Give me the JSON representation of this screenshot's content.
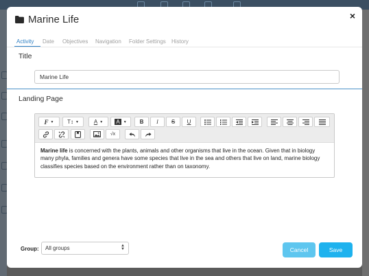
{
  "modal": {
    "title": "Marine Life",
    "close_label": "×"
  },
  "tabs": [
    {
      "label": "Activity",
      "active": true
    },
    {
      "label": "Date"
    },
    {
      "label": "Objectives"
    },
    {
      "label": "Navigation"
    },
    {
      "label": "Folder Settings"
    },
    {
      "label": "History"
    }
  ],
  "title_section": {
    "label": "Title",
    "value": "Marine Life"
  },
  "landing_section": {
    "label": "Landing Page"
  },
  "toolbar": {
    "font_label": "F",
    "size_label": "T↕",
    "color_label": "A",
    "bg_label": "A",
    "bold_label": "B",
    "italic_label": "I",
    "strike_label": "S",
    "underline_label": "U",
    "formula_label": "√x"
  },
  "editor": {
    "bold_lead": "Marine life",
    "body": " is concerned with the plants, animals and other organisms that live in the ocean. Given that in biology many phyla, families and genera have some species that live in the sea and others that live on land, marine biology classifies species based on the environment rather than on taxonomy."
  },
  "footer": {
    "group_label": "Group:",
    "group_value": "All groups",
    "cancel_label": "Cancel",
    "save_label": "Save"
  },
  "colors": {
    "accent": "#2e7fc3",
    "save": "#1eb2ee",
    "cancel": "#5ec6ef"
  }
}
